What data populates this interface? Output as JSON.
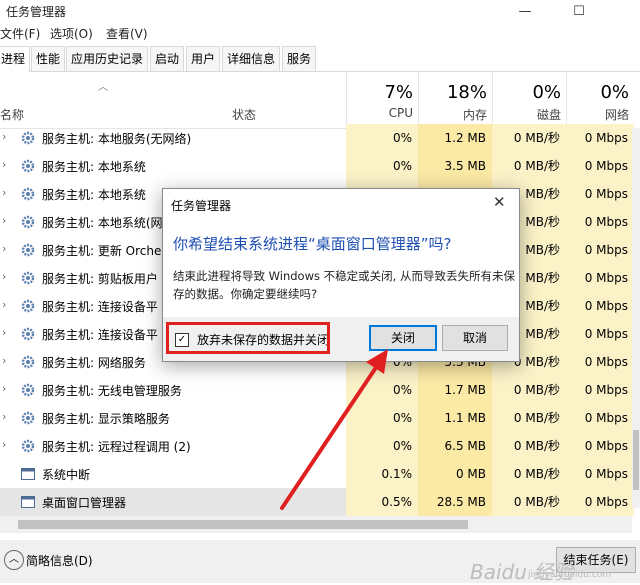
{
  "window": {
    "title": "任务管理器",
    "min_icon": "minimize-icon",
    "max_icon": "maximize-icon"
  },
  "menu": [
    "文件(F)",
    "选项(O)",
    "查看(V)"
  ],
  "tabs": [
    "进程",
    "性能",
    "应用历史记录",
    "启动",
    "用户",
    "详细信息",
    "服务"
  ],
  "columns": {
    "name": "名称",
    "status": "状态",
    "cpu": {
      "pct": "7%",
      "label": "CPU"
    },
    "memory": {
      "pct": "18%",
      "label": "内存"
    },
    "disk": {
      "pct": "0%",
      "label": "磁盘"
    },
    "network": {
      "pct": "0%",
      "label": "网络"
    }
  },
  "rows": [
    {
      "name": "服务主机: 本地服务(无网络)",
      "cpu": "0%",
      "mem": "1.2 MB",
      "disk": "0 MB/秒",
      "net": "0 Mbps"
    },
    {
      "name": "服务主机: 本地系统",
      "cpu": "0%",
      "mem": "3.5 MB",
      "disk": "0 MB/秒",
      "net": "0 Mbps"
    },
    {
      "name": "服务主机: 本地系统",
      "cpu": "",
      "mem": "",
      "disk": "MB/秒",
      "net": "0 Mbps"
    },
    {
      "name": "服务主机: 本地系统(网",
      "cpu": "",
      "mem": "",
      "disk": "MB/秒",
      "net": "0 Mbps"
    },
    {
      "name": "服务主机: 更新 Orche",
      "cpu": "",
      "mem": "",
      "disk": "MB/秒",
      "net": "0 Mbps"
    },
    {
      "name": "服务主机: 剪贴板用户",
      "cpu": "",
      "mem": "",
      "disk": "MB/秒",
      "net": "0 Mbps"
    },
    {
      "name": "服务主机: 连接设备平",
      "cpu": "",
      "mem": "",
      "disk": "MB/秒",
      "net": "0 Mbps"
    },
    {
      "name": "服务主机: 连接设备平",
      "cpu": "",
      "mem": "",
      "disk": "MB/秒",
      "net": "0 Mbps"
    },
    {
      "name": "服务主机: 网络服务",
      "cpu": "0%",
      "mem": "5.3 MB",
      "disk": "0 MB/秒",
      "net": "0 Mbps"
    },
    {
      "name": "服务主机: 无线电管理服务",
      "cpu": "0%",
      "mem": "1.7 MB",
      "disk": "0 MB/秒",
      "net": "0 Mbps"
    },
    {
      "name": "服务主机: 显示策略服务",
      "cpu": "0%",
      "mem": "1.1 MB",
      "disk": "0 MB/秒",
      "net": "0 Mbps"
    },
    {
      "name": "服务主机: 远程过程调用 (2)",
      "cpu": "0%",
      "mem": "6.5 MB",
      "disk": "0 MB/秒",
      "net": "0 Mbps"
    },
    {
      "name": "系统中断",
      "cpu": "0.1%",
      "mem": "0 MB",
      "disk": "0 MB/秒",
      "net": "0 Mbps"
    },
    {
      "name": "桌面窗口管理器",
      "cpu": "0.5%",
      "mem": "28.5 MB",
      "disk": "0 MB/秒",
      "net": "0 Mbps"
    }
  ],
  "footer": {
    "summary": "简略信息(D)",
    "end_task": "结束任务(E)"
  },
  "dialog": {
    "title": "任务管理器",
    "heading": "你希望结束系统进程“桌面窗口管理器”吗?",
    "body": "结束此进程将导致 Windows 不稳定或关闭, 从而导致丢失所有未保存的数据。你确定要继续吗?",
    "checkbox_label": "放弃未保存的数据并关闭",
    "checkbox_mark": "✓",
    "close_button": "关闭",
    "cancel_button": "取消"
  },
  "annotation_color": "#e02020",
  "watermark": {
    "main": "Baidu 经验",
    "sub": "jingyan.baidu.com"
  }
}
